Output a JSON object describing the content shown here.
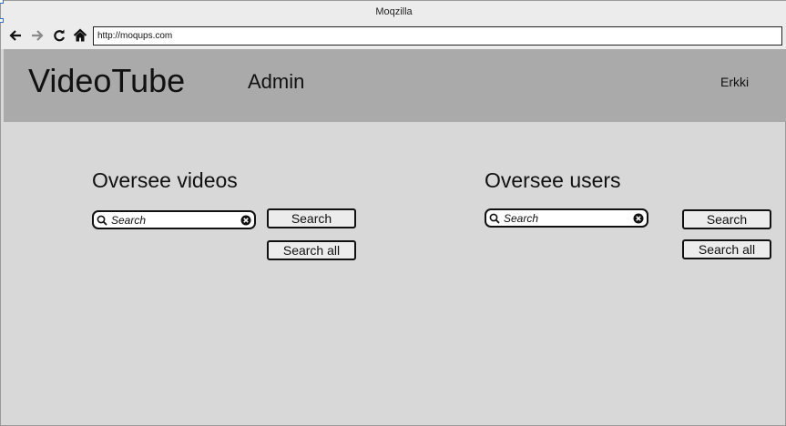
{
  "browser": {
    "title": "Moqzilla",
    "url": "http://moqups.com"
  },
  "header": {
    "brand": "VideoTube",
    "section": "Admin",
    "user": "Erkki"
  },
  "panels": {
    "videos": {
      "title": "Oversee videos",
      "search_placeholder": "Search",
      "search_label": "Search",
      "search_all_label": "Search all"
    },
    "users": {
      "title": "Oversee users",
      "search_placeholder": "Search",
      "search_label": "Search",
      "search_all_label": "Search all"
    }
  },
  "icons": {
    "back": "arrow-left-icon",
    "forward": "arrow-right-icon",
    "reload": "reload-icon",
    "home": "home-icon",
    "search": "magnifier-icon",
    "clear": "clear-icon"
  }
}
